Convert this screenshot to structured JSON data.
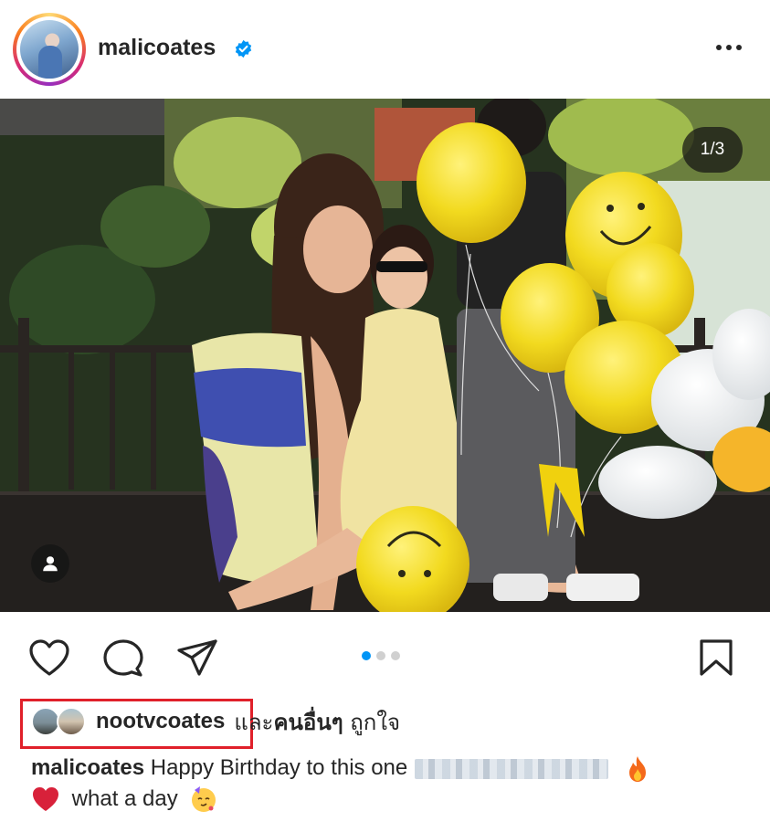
{
  "post": {
    "username": "malicoates",
    "verified": true,
    "more_icon": "more-horizontal-icon"
  },
  "media": {
    "counter": "1/3",
    "tag_icon": "person-tag-icon",
    "carousel_total": 3,
    "carousel_active_index": 0
  },
  "actions": {
    "like_icon": "heart-icon",
    "comment_icon": "comment-bubble-icon",
    "share_icon": "paper-plane-icon",
    "save_icon": "bookmark-icon"
  },
  "likes": {
    "name": "nootvcoates",
    "connector": "และ",
    "others": "คนอื่นๆ",
    "suffix": "ถูกใจ"
  },
  "caption": {
    "username": "malicoates",
    "text": "Happy Birthday to this one",
    "line2": "what a day"
  },
  "colors": {
    "accent_blue": "#0095f6",
    "verified_blue": "#0095f6",
    "highlight_red": "#e0202a",
    "text": "#262626"
  }
}
